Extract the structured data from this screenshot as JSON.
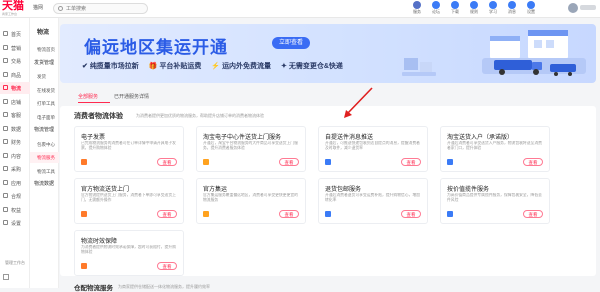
{
  "app": {
    "logo": "天猫",
    "logo_sub": "商家工作台",
    "shop_tag": "猫网",
    "search_placeholder": "工单搜索"
  },
  "toolbar": [
    {
      "label": "服务",
      "color": "#5470c6"
    },
    {
      "label": "论坛",
      "color": "#3b7bf6"
    },
    {
      "label": "下载",
      "color": "#3b7bf6"
    },
    {
      "label": "规则",
      "color": "#3b7bf6"
    },
    {
      "label": "学习",
      "color": "#3b7bf6"
    },
    {
      "label": "消息",
      "color": "#3b7bf6"
    },
    {
      "label": "设置",
      "color": "#3b7bf6"
    }
  ],
  "sidebar": {
    "items": [
      {
        "label": "首页",
        "active": false
      },
      {
        "label": "营销",
        "active": false
      },
      {
        "label": "交易",
        "active": false
      },
      {
        "label": "商品",
        "active": false
      },
      {
        "label": "物流",
        "active": true
      },
      {
        "label": "店铺",
        "active": false
      },
      {
        "label": "客服",
        "active": false
      },
      {
        "label": "数据",
        "active": false
      },
      {
        "label": "财务",
        "active": false
      },
      {
        "label": "内容",
        "active": false
      },
      {
        "label": "采购",
        "active": false
      },
      {
        "label": "应用",
        "active": false
      },
      {
        "label": "合规",
        "active": false
      },
      {
        "label": "权益",
        "active": false
      },
      {
        "label": "设置",
        "active": false
      }
    ],
    "footer": "管理工作台"
  },
  "subnav": {
    "title": "物流",
    "items": [
      {
        "label": "物流首页",
        "group": false,
        "active": false
      },
      {
        "label": "发货管理",
        "group": true,
        "active": false
      },
      {
        "label": "发货",
        "group": false,
        "active": false
      },
      {
        "label": "在线发货",
        "group": false,
        "active": false
      },
      {
        "label": "打单工具",
        "group": false,
        "active": false
      },
      {
        "label": "电子面单",
        "group": false,
        "active": false
      },
      {
        "label": "物流管理",
        "group": true,
        "active": false
      },
      {
        "label": "包裹中心",
        "group": false,
        "active": false
      },
      {
        "label": "物流服务",
        "group": false,
        "active": true
      },
      {
        "label": "物流工具",
        "group": false,
        "active": false
      },
      {
        "label": "物流数据",
        "group": true,
        "active": false
      }
    ]
  },
  "banner": {
    "title": "偏远地区集运开通",
    "button": "立即查看",
    "features": [
      "纯揽量市场拉新",
      "平台补贴运费",
      "运内外免费流量",
      "无需变更仓&快递"
    ]
  },
  "tabs": [
    {
      "label": "全部服务",
      "active": true
    },
    {
      "label": "已开通服务详情",
      "active": false
    }
  ],
  "section": {
    "title": "消费者物流体验",
    "desc": "为消费者提供更加优质的物流服务，帮助提升店铺订单的消费者物流体验"
  },
  "cards": [
    {
      "title": "电子发票",
      "desc": "已完成物流服务的消费者可在订单详情中申请开具电子发票，提升购物体验",
      "button": "查看",
      "icon_color": "#ff7a2a"
    },
    {
      "title": "淘宝电子中心件送货上门服务",
      "desc": "开通后，淘宝平台物流服务的大件商品可享受送货上门服务，提升消费者服务体验",
      "button": "查看",
      "icon_color": "#ffa21f"
    },
    {
      "title": "自提送件消息推送",
      "desc": "开通后，可推送快递包裹到达自提点的消息，提醒消费者及时取件，减少退货率",
      "button": "查看",
      "icon_color": "#3b7bf6"
    },
    {
      "title": "淘宝送货入户（承诺版）",
      "desc": "开通后消费者可享受送货入户服务，物流包裹将送至消费者家门口，提升体验",
      "button": "查看",
      "icon_color": "#3b7bf6"
    },
    {
      "title": "官方物流送货上门",
      "desc": "官方物流提供送货上门服务，消费者下单即可享受送货上门，无需额外操作",
      "button": "查看",
      "icon_color": "#ff7a2a"
    },
    {
      "title": "官方集运",
      "desc": "官方集运服务覆盖偏远地区，消费者可享受更快更便宜的物流服务",
      "button": "查看",
      "icon_color": "#ffa21f"
    },
    {
      "title": "退货包邮服务",
      "desc": "开通后消费者退货可享受运费补贴，提升购物信心，增加转化率",
      "button": "查看",
      "icon_color": "#3b7bf6"
    },
    {
      "title": "按价值揽件服务",
      "desc": "为高价值商品提供专属揽件服务，保障包裹安全，降低丢件风险",
      "button": "查看",
      "icon_color": "#3b7bf6"
    },
    {
      "title": "物流时效保障",
      "desc": "为消费者提供物流时效承诺保障，超时可获赔付，提升购物体验",
      "button": "查看",
      "icon_color": "#ff7a2a"
    }
  ],
  "bottom_section": {
    "title": "仓配物流服务",
    "desc": "为商家提供仓储配送一体化物流服务，提升履约效率"
  }
}
